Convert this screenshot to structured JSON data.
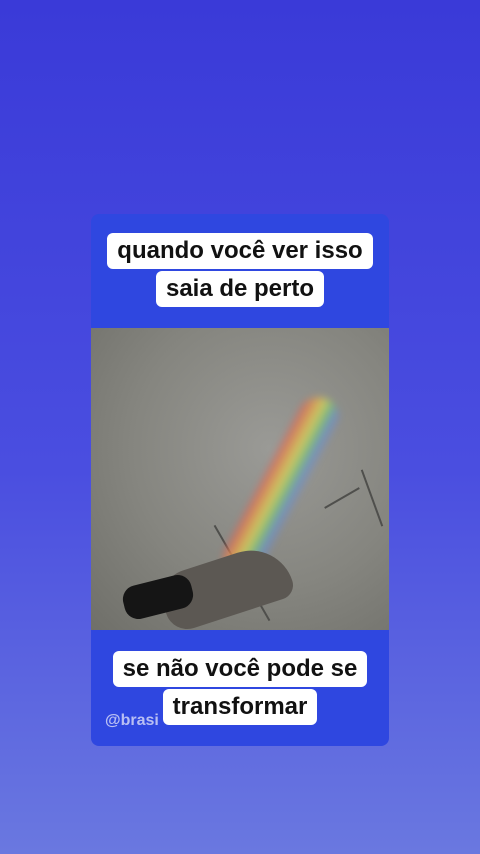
{
  "caption_top": {
    "line1": "quando você ver isso",
    "line2": "saia de perto"
  },
  "caption_bottom": {
    "line1": "se não você pode se",
    "line2": "transformar"
  },
  "watermark": "@brasi",
  "colors": {
    "background_top": "#3a3ad8",
    "background_bottom": "#6a78e0",
    "card": "#2f47e0",
    "caption_bg": "#ffffff"
  }
}
